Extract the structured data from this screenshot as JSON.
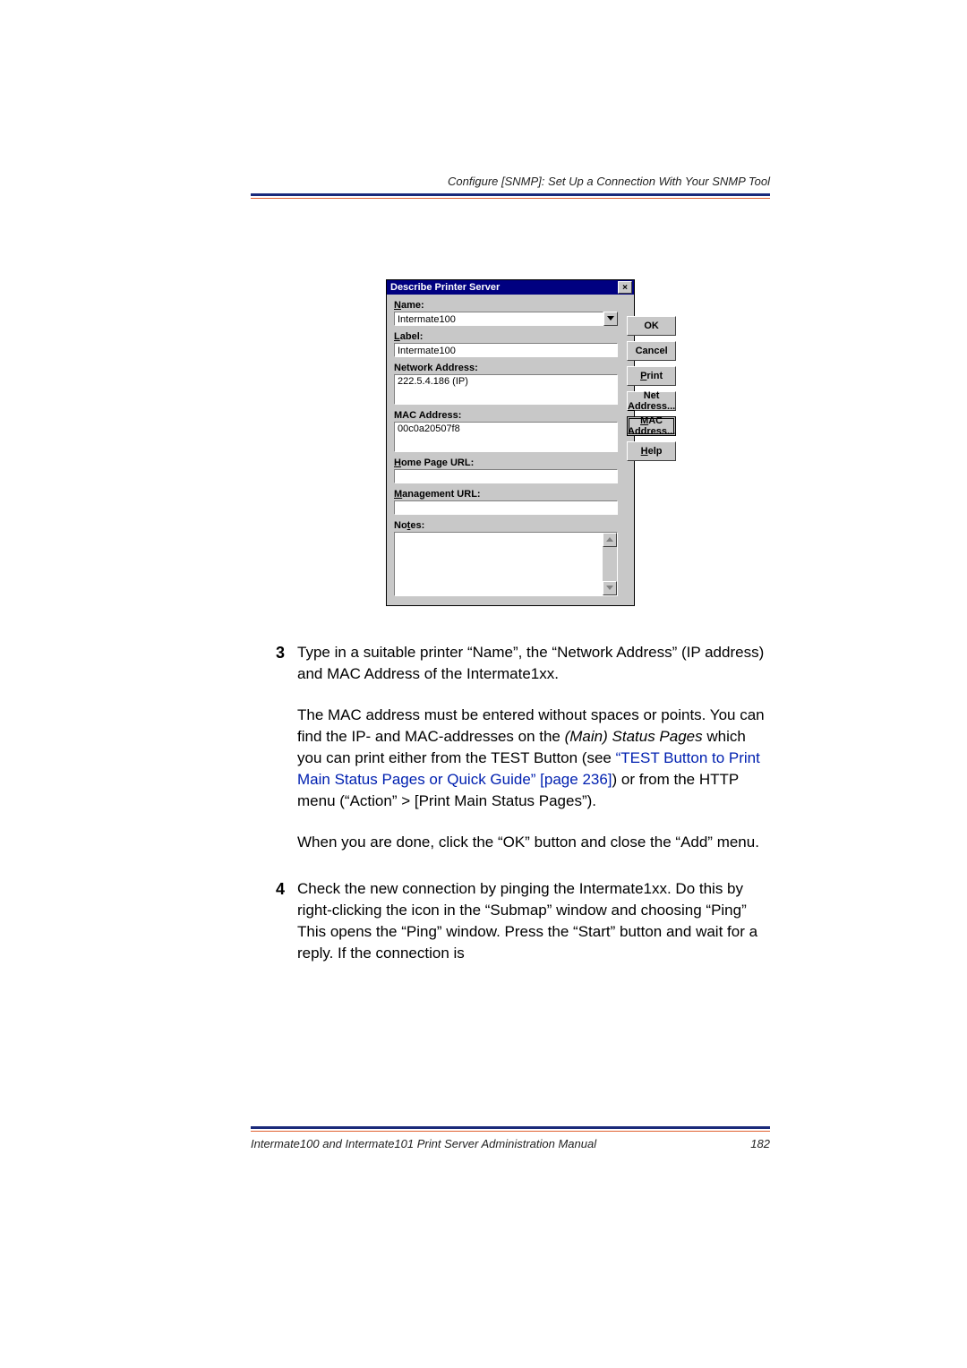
{
  "header": {
    "section_title": "Configure [SNMP]: Set Up a Connection With Your SNMP Tool"
  },
  "dialog": {
    "title": "Describe Printer Server",
    "close_glyph": "×",
    "labels": {
      "name": "ame:",
      "name_u": "N",
      "label": "abel:",
      "label_u": "L",
      "network_address": "Network Address:",
      "mac_address": "MAC Address:",
      "home_page_url": "ome Page URL:",
      "home_page_url_u": "H",
      "management_url": "anagement URL:",
      "management_url_u": "M",
      "notes": "No",
      "notes_u": "t",
      "notes_rest": "es:"
    },
    "values": {
      "name": "Intermate100",
      "label": "Intermate100",
      "network_address": "222.5.4.186 (IP)",
      "mac_address": "00c0a20507f8",
      "home_page_url": "",
      "management_url": ""
    },
    "buttons": {
      "ok": "OK",
      "cancel": "Cancel",
      "print_u": "P",
      "print": "rint",
      "net_addr_pre": "Net ",
      "net_addr_u": "A",
      "net_addr_post": "ddress...",
      "mac_addr_u": "M",
      "mac_addr_post": "AC Address...",
      "help_u": "H",
      "help": "elp"
    }
  },
  "steps": {
    "s3": {
      "num": "3",
      "p1": "Type in a suitable printer “Name”, the “Network Address” (IP address) and MAC Address of the Intermate1xx.",
      "p2a": "The MAC address must be entered without spaces or points. You can find the IP- and MAC-addresses on the ",
      "p2_i": "(Main) Status Pages",
      "p2b": " which you can print either from the TEST Button (see ",
      "p2_link": "“TEST Button to Print Main Status Pages or Quick Guide” [page 236]",
      "p2c": ") or from the HTTP menu (“Action” > [Print Main Status Pages”).",
      "p3": "When you are done, click the “OK” button and close the “Add” menu."
    },
    "s4": {
      "num": "4",
      "p1": "Check the new connection by pinging the Intermate1xx. Do this by right-clicking the icon in the “Submap” window and choosing “Ping” This opens the “Ping” window. Press the “Start” button and wait for a reply. If the connection is"
    }
  },
  "footer": {
    "doc_title": "Intermate100 and Intermate101 Print Server Administration Manual",
    "page_number": "182"
  }
}
